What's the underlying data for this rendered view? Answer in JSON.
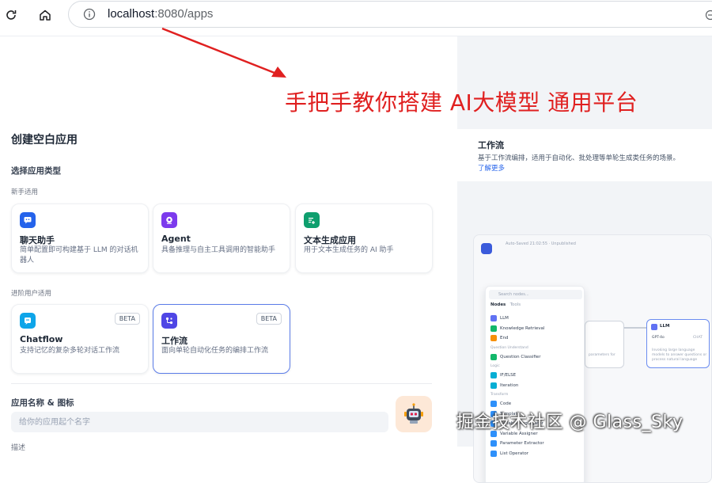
{
  "browser": {
    "url_host": "localhost",
    "url_rest": ":8080/apps"
  },
  "annotation": "手把手教你搭建 AI大模型 通用平台",
  "page": {
    "title": "创建空白应用",
    "choose_type_label": "选择应用类型",
    "group_beginner": "新手适用",
    "group_advanced": "进阶用户适用",
    "app_types": [
      {
        "name": "聊天助手",
        "desc": "简单配置即可构建基于 LLM 的对话机器人",
        "icon": "chat-bubble-icon",
        "color": "#2563eb"
      },
      {
        "name": "Agent",
        "desc": "具备推理与自主工具调用的智能助手",
        "icon": "agent-bot-icon",
        "color": "#7c3aed"
      },
      {
        "name": "文本生成应用",
        "desc": "用于文本生成任务的 AI 助手",
        "icon": "text-generate-icon",
        "color": "#0e9f6e"
      },
      {
        "name": "Chatflow",
        "desc": "支持记忆的复杂多轮对话工作流",
        "icon": "chatflow-icon",
        "color": "#0ea5e9",
        "badge": "BETA"
      },
      {
        "name": "工作流",
        "desc": "面向单轮自动化任务的编排工作流",
        "icon": "workflow-icon",
        "color": "#4f46e5",
        "badge": "BETA",
        "selected": true
      }
    ],
    "name_icon_label": "应用名称 & 图标",
    "name_placeholder": "给你的应用起个名字",
    "cut_label": "描述"
  },
  "preview": {
    "title": "工作流",
    "desc": "基于工作流编排，适用于自动化、批处理等单轮生成类任务的场景。",
    "learn_more": "了解更多",
    "canvas_caption": "Auto-Saved 21:02:55 · Unpublished",
    "search_placeholder": "Search nodes...",
    "tab_nodes": "Nodes",
    "tab_tools": "Tools",
    "llm_node_title": "LLM",
    "llm_node_model": "GPT-4o",
    "llm_node_mode": "CHAT",
    "llm_node_text": "Invoking large language models to answer questions or process natural language",
    "start_node_text": "parameters for",
    "node_groups": [
      {
        "group": "",
        "items": [
          {
            "label": "LLM",
            "color": "#6172f3"
          },
          {
            "label": "Knowledge Retrieval",
            "color": "#12b76a"
          },
          {
            "label": "End",
            "color": "#f79009"
          }
        ]
      },
      {
        "group": "Question Understand",
        "items": [
          {
            "label": "Question Classifier",
            "color": "#12b76a"
          }
        ]
      },
      {
        "group": "Logic",
        "items": [
          {
            "label": "IF/ELSE",
            "color": "#06aed4"
          },
          {
            "label": "Iteration",
            "color": "#06aed4"
          }
        ]
      },
      {
        "group": "Transform",
        "items": [
          {
            "label": "Code",
            "color": "#2e90fa"
          },
          {
            "label": "Template",
            "color": "#2e90fa"
          },
          {
            "label": "Variable Aggregator",
            "color": "#2e90fa"
          },
          {
            "label": "Variable Assigner",
            "color": "#2e90fa"
          },
          {
            "label": "Parameter Extractor",
            "color": "#2e90fa"
          }
        ]
      },
      {
        "group": "",
        "items": [
          {
            "label": "List Operator",
            "color": "#2e90fa"
          }
        ]
      }
    ]
  },
  "watermark": "掘金技术社区 @ Glass_Sky"
}
